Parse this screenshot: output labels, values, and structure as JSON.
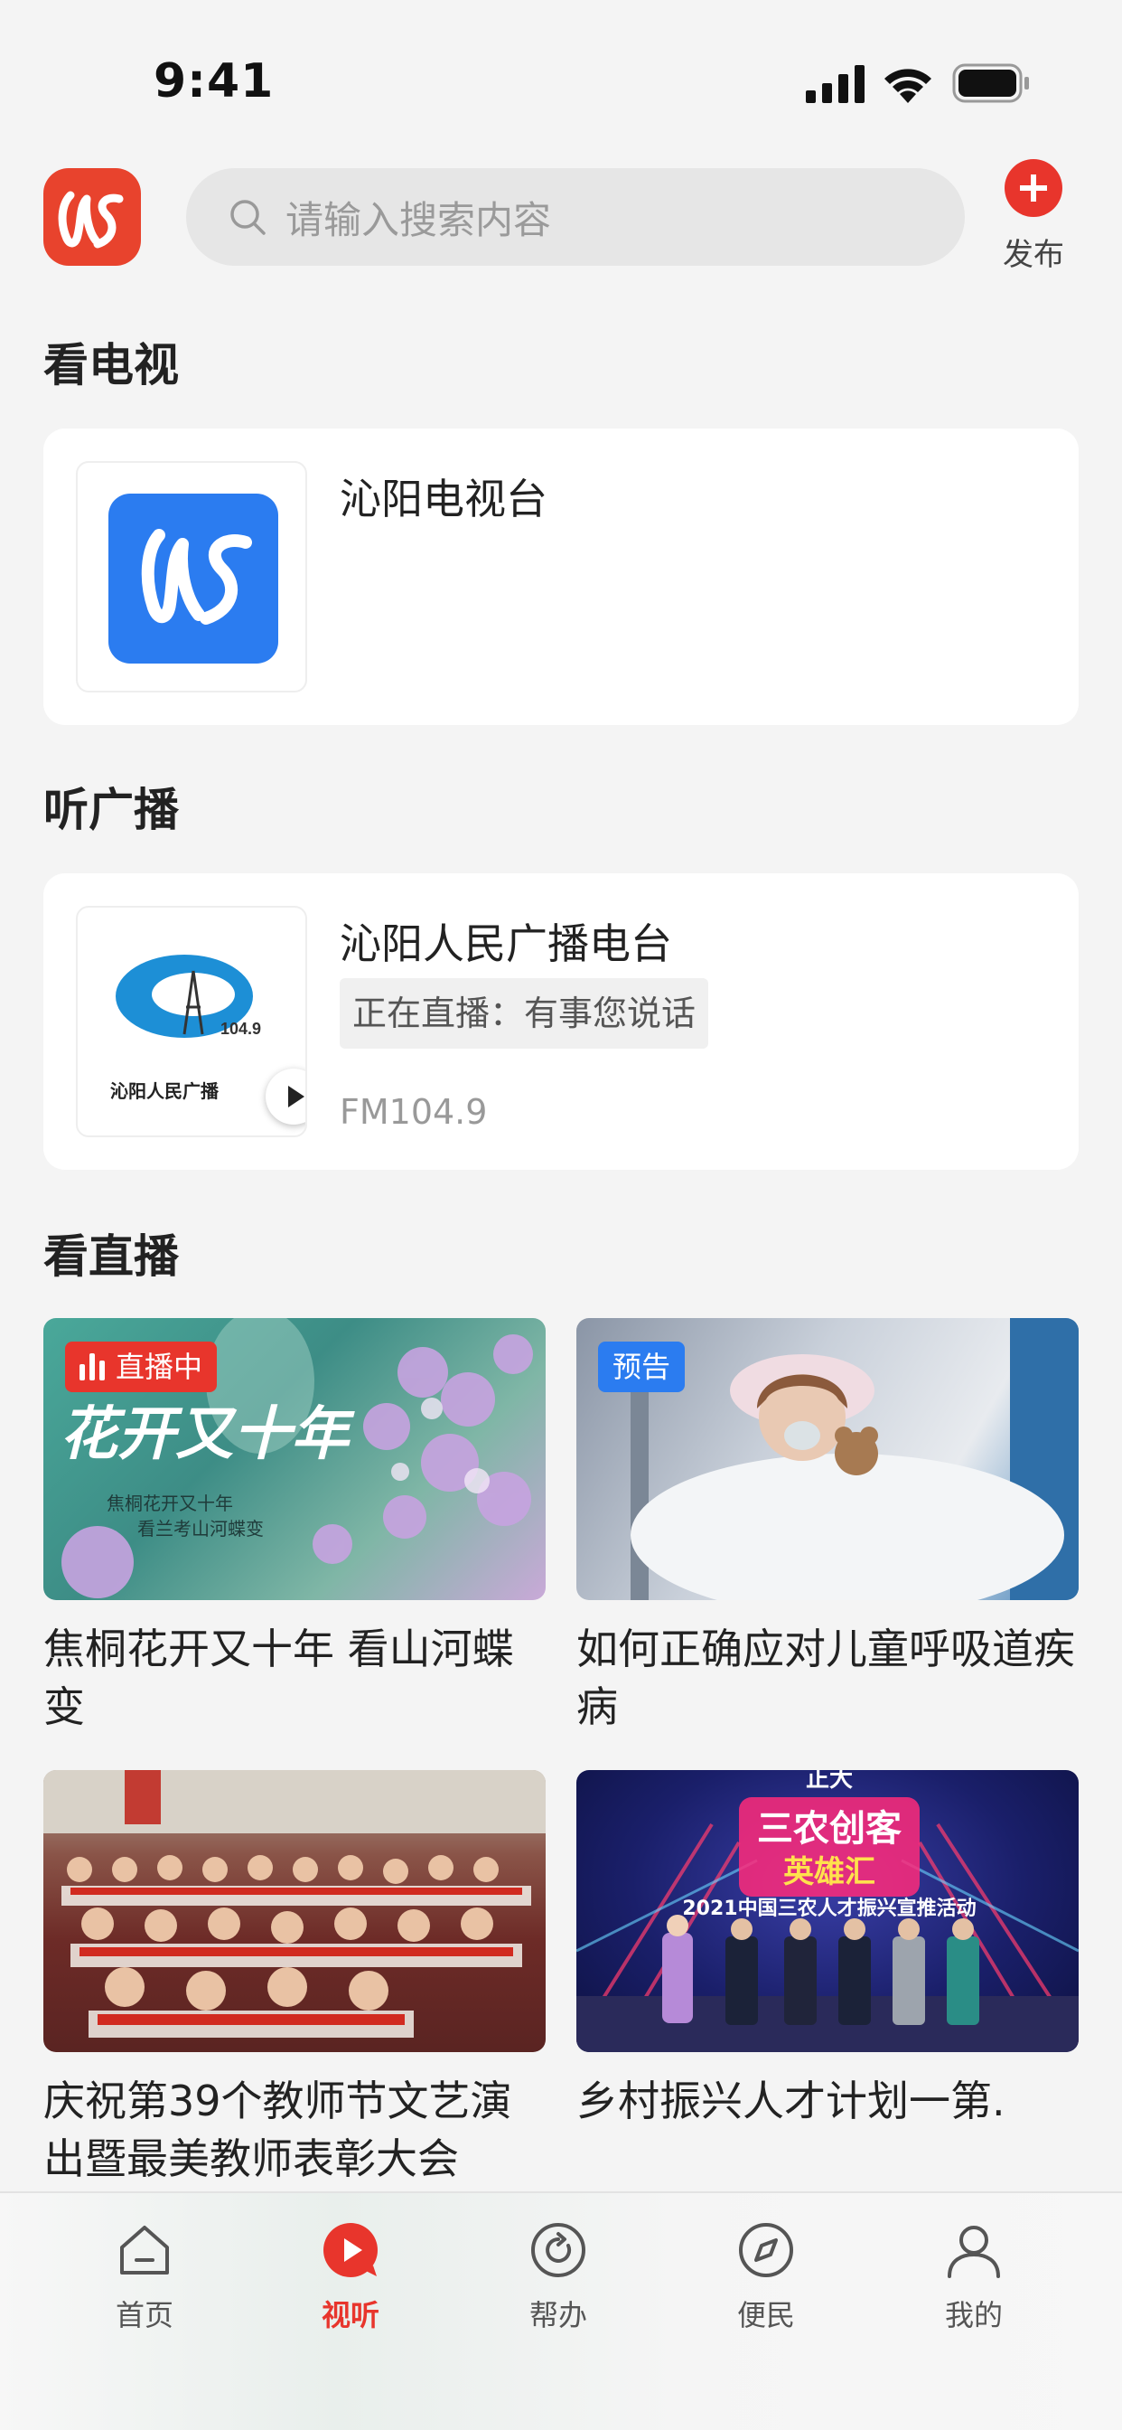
{
  "status": {
    "time": "9:41"
  },
  "header": {
    "search_placeholder": "请输入搜索内容",
    "publish_label": "发布",
    "accent": "#e8352c"
  },
  "sections": {
    "tv_title": "看电视",
    "radio_title": "听广播",
    "live_title": "看直播"
  },
  "tv": {
    "name": "沁阳电视台"
  },
  "radio": {
    "name": "沁阳人民广播电台",
    "now_playing": "正在直播：有事您说话",
    "frequency": "FM104.9",
    "logo_freq": "104.9",
    "logo_text": "沁阳人民广播"
  },
  "live_items": [
    {
      "badge": "直播中",
      "caption": "焦桐花开又十年 看山河蝶变",
      "img_text1": "花开又十年",
      "img_text2": "焦桐花开又十年",
      "img_text3": "看兰考山河蝶变"
    },
    {
      "badge": "预告",
      "caption": "如何正确应对儿童呼吸道疾病"
    },
    {
      "caption": "庆祝第39个教师节文艺演出暨最美教师表彰大会"
    },
    {
      "caption": "乡村振兴人才计划一第.",
      "img_text1": "正大",
      "img_text2": "三农创客",
      "img_text3": "英雄汇",
      "img_text4": "2021中国三农人才振兴宣推活动"
    }
  ],
  "tabbar": [
    {
      "label": "首页",
      "icon": "home-icon"
    },
    {
      "label": "视听",
      "icon": "play-icon",
      "active": true
    },
    {
      "label": "帮办",
      "icon": "help-icon"
    },
    {
      "label": "便民",
      "icon": "compass-icon"
    },
    {
      "label": "我的",
      "icon": "user-icon"
    }
  ]
}
